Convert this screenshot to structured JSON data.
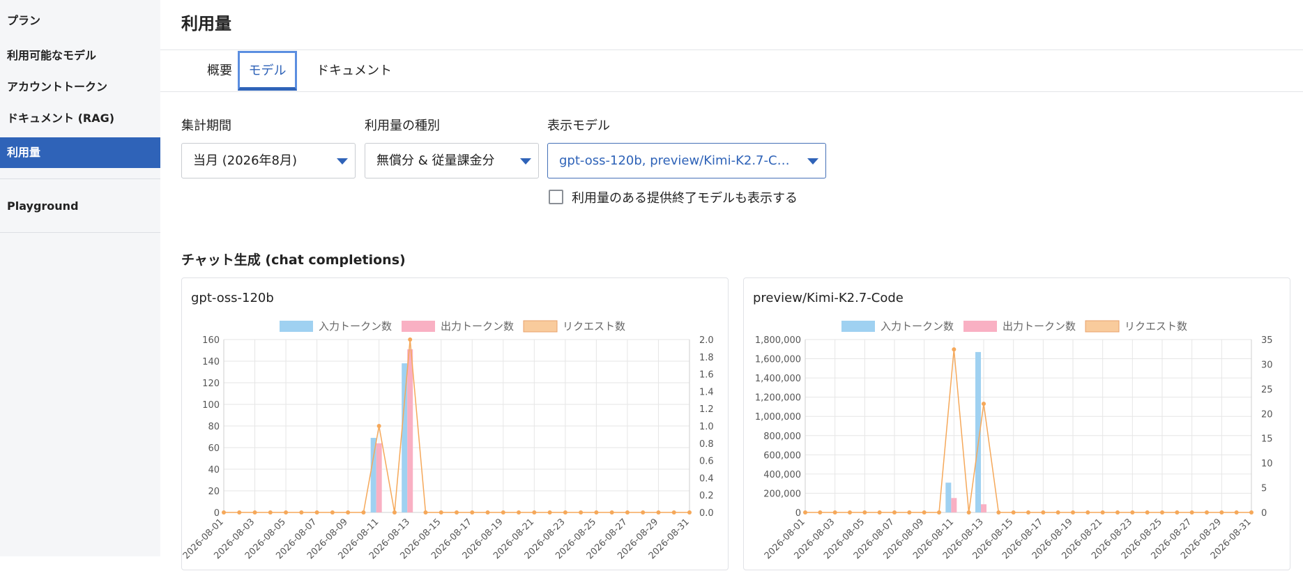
{
  "sidebar": {
    "items": [
      {
        "label": "プラン"
      },
      {
        "label": "利用可能なモデル"
      },
      {
        "label": "アカウントトークン"
      },
      {
        "label": "ドキュメント (RAG)"
      },
      {
        "label": "利用量",
        "active": true
      },
      {
        "label": "Playground"
      }
    ]
  },
  "page": {
    "title": "利用量",
    "tabs": [
      {
        "label": "概要"
      },
      {
        "label": "モデル",
        "active": true
      },
      {
        "label": "ドキュメント"
      }
    ]
  },
  "filters": {
    "period": {
      "label": "集計期間",
      "value": "当月 (2026年8月)"
    },
    "usage_type": {
      "label": "利用量の種別",
      "value": "無償分 & 従量課金分"
    },
    "models": {
      "label": "表示モデル",
      "value": "gpt-oss-120b, preview/Kimi-K2.7-Code"
    },
    "show_deprecated": {
      "label": "利用量のある提供終了モデルも表示する",
      "checked": false
    }
  },
  "section": {
    "title": "チャット生成 (chat completions)"
  },
  "colors": {
    "input": "#9fd1f1",
    "output": "#f9b0c3",
    "requests": "#f5a85a",
    "accent": "#2f63b8"
  },
  "chart_data": [
    {
      "type": "bar",
      "title": "gpt-oss-120b",
      "legend": [
        "入力トークン数",
        "出力トークン数",
        "リクエスト数"
      ],
      "legend_position": "top",
      "categories": [
        "2026-08-01",
        "2026-08-02",
        "2026-08-03",
        "2026-08-04",
        "2026-08-05",
        "2026-08-06",
        "2026-08-07",
        "2026-08-08",
        "2026-08-09",
        "2026-08-10",
        "2026-08-11",
        "2026-08-12",
        "2026-08-13",
        "2026-08-14",
        "2026-08-15",
        "2026-08-16",
        "2026-08-17",
        "2026-08-18",
        "2026-08-19",
        "2026-08-20",
        "2026-08-21",
        "2026-08-22",
        "2026-08-23",
        "2026-08-24",
        "2026-08-25",
        "2026-08-26",
        "2026-08-27",
        "2026-08-28",
        "2026-08-29",
        "2026-08-30",
        "2026-08-31"
      ],
      "tick_labels": [
        "2026-08-01",
        "2026-08-03",
        "2026-08-05",
        "2026-08-07",
        "2026-08-09",
        "2026-08-11",
        "2026-08-13",
        "2026-08-15",
        "2026-08-17",
        "2026-08-19",
        "2026-08-21",
        "2026-08-23",
        "2026-08-25",
        "2026-08-27",
        "2026-08-29",
        "2026-08-31"
      ],
      "series": [
        {
          "name": "入力トークン数",
          "axis": "left",
          "values": [
            0,
            0,
            0,
            0,
            0,
            0,
            0,
            0,
            0,
            0,
            69,
            0,
            138,
            0,
            0,
            0,
            0,
            0,
            0,
            0,
            0,
            0,
            0,
            0,
            0,
            0,
            0,
            0,
            0,
            0,
            0
          ]
        },
        {
          "name": "出力トークン数",
          "axis": "left",
          "values": [
            0,
            0,
            0,
            0,
            0,
            0,
            0,
            0,
            0,
            0,
            64,
            0,
            151,
            0,
            0,
            0,
            0,
            0,
            0,
            0,
            0,
            0,
            0,
            0,
            0,
            0,
            0,
            0,
            0,
            0,
            0
          ]
        },
        {
          "name": "リクエスト数",
          "axis": "right",
          "type": "line",
          "values": [
            0,
            0,
            0,
            0,
            0,
            0,
            0,
            0,
            0,
            0,
            1,
            0,
            2,
            0,
            0,
            0,
            0,
            0,
            0,
            0,
            0,
            0,
            0,
            0,
            0,
            0,
            0,
            0,
            0,
            0,
            0
          ]
        }
      ],
      "ylim": [
        0,
        160
      ],
      "y_ticks": [
        0,
        20,
        40,
        60,
        80,
        100,
        120,
        140,
        160
      ],
      "y2lim": [
        0,
        2
      ],
      "y2_ticks": [
        0,
        0.2,
        0.4,
        0.6,
        0.8,
        1.0,
        1.2,
        1.4,
        1.6,
        1.8,
        2.0
      ],
      "y2_decimals": 1,
      "grid": true
    },
    {
      "type": "bar",
      "title": "preview/Kimi-K2.7-Code",
      "legend": [
        "入力トークン数",
        "出力トークン数",
        "リクエスト数"
      ],
      "legend_position": "top",
      "categories": [
        "2026-08-01",
        "2026-08-02",
        "2026-08-03",
        "2026-08-04",
        "2026-08-05",
        "2026-08-06",
        "2026-08-07",
        "2026-08-08",
        "2026-08-09",
        "2026-08-10",
        "2026-08-11",
        "2026-08-12",
        "2026-08-13",
        "2026-08-14",
        "2026-08-15",
        "2026-08-16",
        "2026-08-17",
        "2026-08-18",
        "2026-08-19",
        "2026-08-20",
        "2026-08-21",
        "2026-08-22",
        "2026-08-23",
        "2026-08-24",
        "2026-08-25",
        "2026-08-26",
        "2026-08-27",
        "2026-08-28",
        "2026-08-29",
        "2026-08-30",
        "2026-08-31"
      ],
      "tick_labels": [
        "2026-08-01",
        "2026-08-03",
        "2026-08-05",
        "2026-08-07",
        "2026-08-09",
        "2026-08-11",
        "2026-08-13",
        "2026-08-15",
        "2026-08-17",
        "2026-08-19",
        "2026-08-21",
        "2026-08-23",
        "2026-08-25",
        "2026-08-27",
        "2026-08-29",
        "2026-08-31"
      ],
      "series": [
        {
          "name": "入力トークン数",
          "axis": "left",
          "values": [
            0,
            0,
            0,
            0,
            0,
            0,
            0,
            0,
            0,
            0,
            310000,
            0,
            1670000,
            0,
            0,
            0,
            0,
            0,
            0,
            0,
            0,
            0,
            0,
            0,
            0,
            0,
            0,
            0,
            0,
            0,
            0
          ]
        },
        {
          "name": "出力トークン数",
          "axis": "left",
          "values": [
            0,
            0,
            0,
            0,
            0,
            0,
            0,
            0,
            0,
            0,
            150000,
            0,
            85000,
            0,
            0,
            0,
            0,
            0,
            0,
            0,
            0,
            0,
            0,
            0,
            0,
            0,
            0,
            0,
            0,
            0,
            0
          ]
        },
        {
          "name": "リクエスト数",
          "axis": "right",
          "type": "line",
          "values": [
            0,
            0,
            0,
            0,
            0,
            0,
            0,
            0,
            0,
            0,
            33,
            0,
            22,
            0,
            0,
            0,
            0,
            0,
            0,
            0,
            0,
            0,
            0,
            0,
            0,
            0,
            0,
            0,
            0,
            0,
            0
          ]
        }
      ],
      "ylim": [
        0,
        1800000
      ],
      "y_ticks": [
        0,
        200000,
        400000,
        600000,
        800000,
        1000000,
        1200000,
        1400000,
        1600000,
        1800000
      ],
      "y2lim": [
        0,
        35
      ],
      "y2_ticks": [
        0,
        5,
        10,
        15,
        20,
        25,
        30,
        35
      ],
      "y2_decimals": 0,
      "grid": true
    }
  ]
}
